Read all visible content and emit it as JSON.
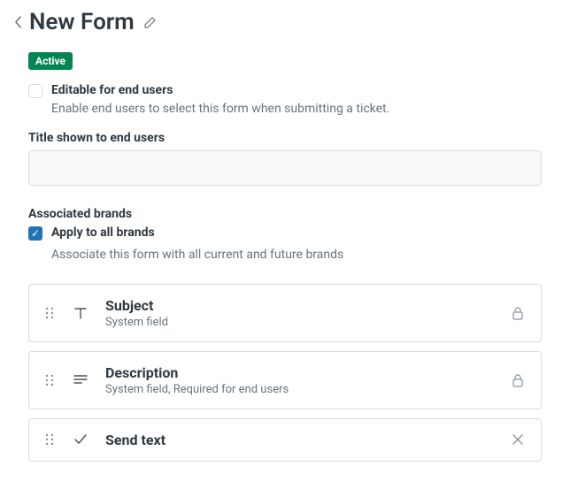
{
  "header": {
    "title": "New Form"
  },
  "status": {
    "badge": "Active"
  },
  "editable": {
    "label": "Editable for end users",
    "helper": "Enable end users to select this form when submitting a ticket.",
    "checked": false
  },
  "title_field": {
    "label": "Title shown to end users",
    "value": ""
  },
  "brands": {
    "section_label": "Associated brands",
    "apply_all_label": "Apply to all brands",
    "apply_all_helper": "Associate this form with all current and future brands",
    "apply_all_checked": true
  },
  "fields": [
    {
      "name": "Subject",
      "meta": "System field",
      "icon": "text",
      "locked": true
    },
    {
      "name": "Description",
      "meta": "System field, Required for end users",
      "icon": "multiline",
      "locked": true
    },
    {
      "name": "Send text",
      "meta": "",
      "icon": "check",
      "locked": false
    }
  ]
}
